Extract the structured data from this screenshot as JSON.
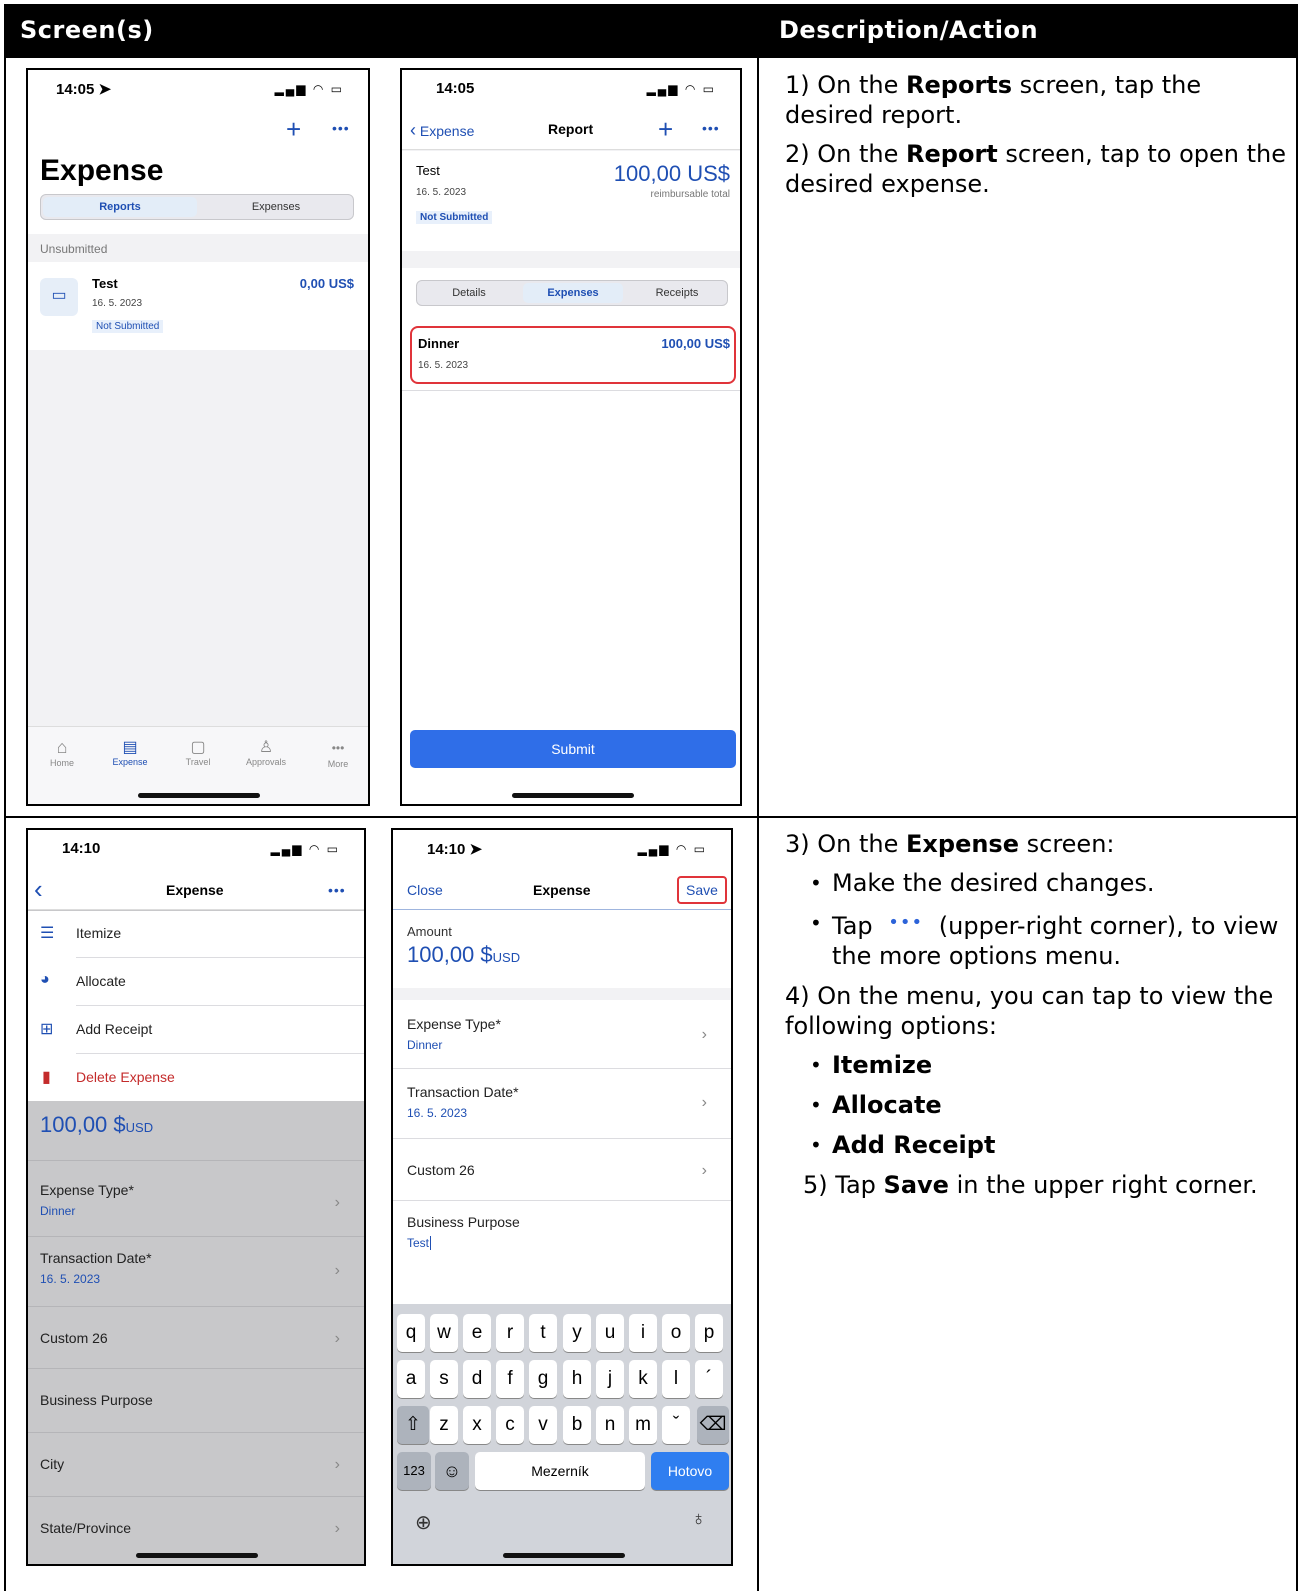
{
  "header": {
    "col1": "Screen(s)",
    "col2": "Description/Action"
  },
  "row1": {
    "desc": [
      {
        "pre": "1) On the ",
        "bold": "Reports",
        "post": " screen, tap the desired report."
      },
      {
        "pre": "2) On the ",
        "bold": "Report",
        "post": " screen, tap to open the desired expense."
      }
    ]
  },
  "row2": {
    "step3": {
      "pre": "3) On the ",
      "bold": "Expense",
      "post": " screen:"
    },
    "bullet1": "Make the desired changes.",
    "bullet2_pre": "Tap",
    "bullet2_post": "(upper-right corner), to view the more options menu.",
    "step4": "4) On the menu, you can tap to view the following options:",
    "options": [
      "Itemize",
      "Allocate",
      "Add Receipt"
    ],
    "step5": {
      "pre": "5) Tap ",
      "bold": "Save",
      "post": " in the upper right corner."
    }
  },
  "phone1": {
    "time": "14:05",
    "title": "Expense",
    "seg": [
      "Reports",
      "Expenses"
    ],
    "section": "Unsubmitted",
    "report": {
      "name": "Test",
      "date": "16. 5. 2023",
      "amount": "0,00 US$",
      "status": "Not Submitted"
    },
    "tabs": [
      {
        "label": "Home",
        "icon": "home-icon"
      },
      {
        "label": "Expense",
        "icon": "expense-icon"
      },
      {
        "label": "Travel",
        "icon": "travel-icon"
      },
      {
        "label": "Approvals",
        "icon": "approvals-icon"
      },
      {
        "label": "More",
        "icon": "more-icon"
      }
    ]
  },
  "phone2": {
    "time": "14:05",
    "back": "Expense",
    "title": "Report",
    "report": {
      "name": "Test",
      "date": "16. 5. 2023",
      "amount": "100,00 US$",
      "sub": "reimbursable total",
      "status": "Not Submitted"
    },
    "seg": [
      "Details",
      "Expenses",
      "Receipts"
    ],
    "expense": {
      "name": "Dinner",
      "date": "16. 5. 2023",
      "amount": "100,00 US$"
    },
    "submit": "Submit"
  },
  "phone3": {
    "time": "14:10",
    "title": "Expense",
    "menu": [
      {
        "label": "Itemize",
        "icon": "list-icon"
      },
      {
        "label": "Allocate",
        "icon": "pie-icon"
      },
      {
        "label": "Add Receipt",
        "icon": "add-receipt-icon"
      },
      {
        "label": "Delete Expense",
        "icon": "trash-icon"
      }
    ],
    "amount": "100,00 $",
    "currency": "USD",
    "fields": [
      {
        "label": "Expense Type*",
        "value": "Dinner"
      },
      {
        "label": "Transaction Date*",
        "value": "16. 5. 2023"
      },
      {
        "label": "Custom 26",
        "value": ""
      },
      {
        "label": "Business Purpose",
        "value": ""
      },
      {
        "label": "City",
        "value": ""
      },
      {
        "label": "State/Province",
        "value": ""
      }
    ]
  },
  "phone4": {
    "time": "14:10",
    "close": "Close",
    "title": "Expense",
    "save": "Save",
    "amount_label": "Amount",
    "amount": "100,00 $",
    "currency": "USD",
    "fields": [
      {
        "label": "Expense Type*",
        "value": "Dinner"
      },
      {
        "label": "Transaction Date*",
        "value": "16. 5. 2023"
      },
      {
        "label": "Custom 26",
        "value": ""
      }
    ],
    "purpose_label": "Business Purpose",
    "purpose_value": "Test",
    "keys_row1": [
      "q",
      "w",
      "e",
      "r",
      "t",
      "y",
      "u",
      "i",
      "o",
      "p"
    ],
    "keys_row2": [
      "a",
      "s",
      "d",
      "f",
      "g",
      "h",
      "j",
      "k",
      "l",
      "´"
    ],
    "keys_row3": [
      "z",
      "x",
      "c",
      "v",
      "b",
      "n",
      "m",
      "ˇ"
    ],
    "key_123": "123",
    "key_space": "Mezerník",
    "key_done": "Hotovo"
  }
}
